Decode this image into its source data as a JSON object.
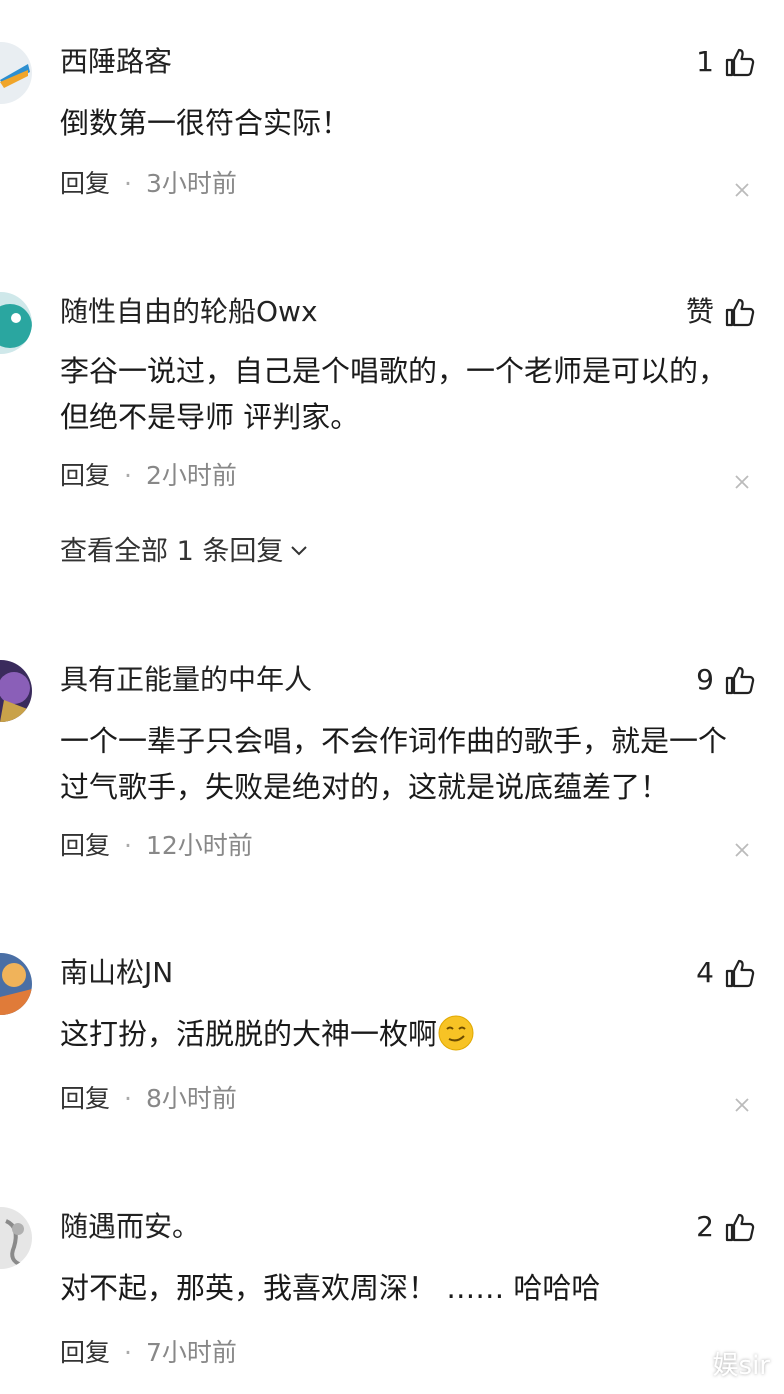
{
  "comments": [
    {
      "username": "西陲路客",
      "like_count": "1",
      "content": "倒数第一很符合实际！",
      "reply_label": "回复",
      "time": "3小时前"
    },
    {
      "username": "随性自由的轮船Owx",
      "like_count": "赞",
      "content": "李谷一说过，自己是个唱歌的，一个老师是可以的，但绝不是导师 评判家。",
      "reply_label": "回复",
      "time": "2小时前",
      "view_all": "查看全部 1 条回复"
    },
    {
      "username": "具有正能量的中年人",
      "like_count": "9",
      "content": "一个一辈子只会唱，不会作词作曲的歌手，就是一个过气歌手，失败是绝对的，这就是说底蕴差了！",
      "reply_label": "回复",
      "time": "12小时前"
    },
    {
      "username": "南山松JN",
      "like_count": "4",
      "content": "这打扮，活脱脱的大神一枚啊",
      "reply_label": "回复",
      "time": "8小时前"
    },
    {
      "username": "随遇而安。",
      "like_count": "2",
      "content": "对不起，那英，我喜欢周深！ …… 哈哈哈",
      "reply_label": "回复",
      "time": "7小时前"
    }
  ],
  "watermark": "娱sir",
  "colors": {
    "text": "#1a1a1a",
    "meta": "#888888",
    "icon": "#222222"
  },
  "icons": {
    "like": "thumbs-up-icon",
    "close": "close-icon",
    "expand": "chevron-down-icon",
    "emoji": "smirk-emoji-icon"
  }
}
